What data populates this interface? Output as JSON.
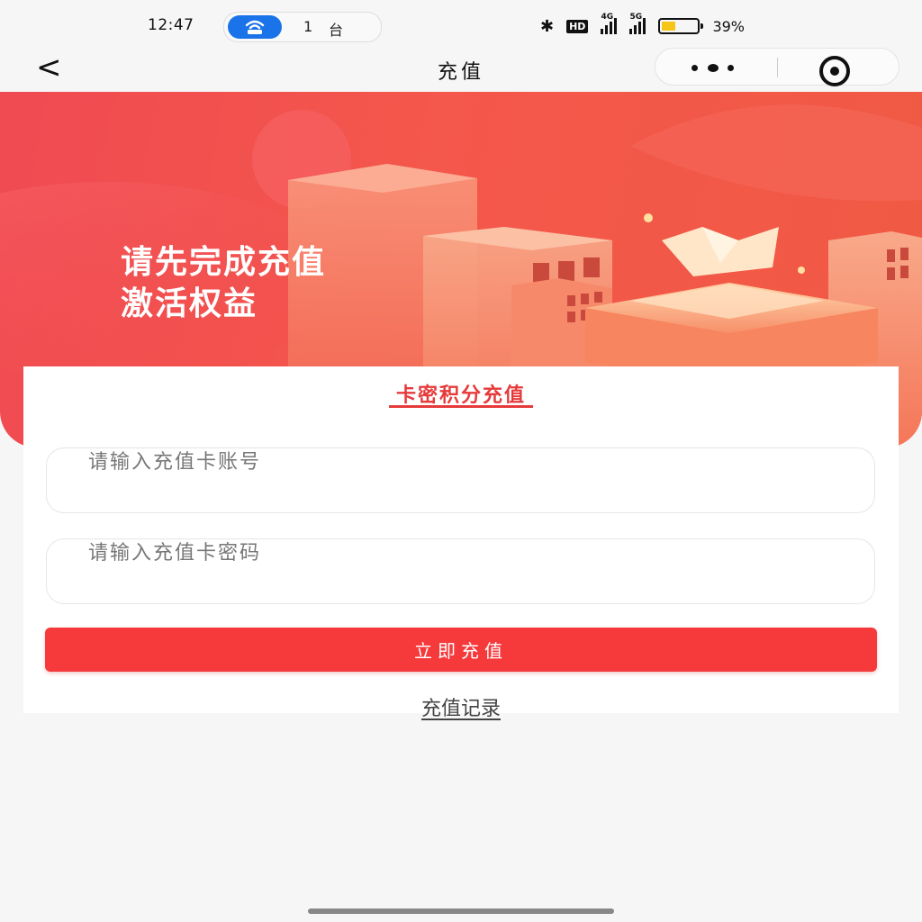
{
  "status_bar": {
    "time": "12:47",
    "hotspot_count": "1",
    "hotspot_unit": "台",
    "network_hd": "HD",
    "signal_1_label": "4G",
    "signal_2_label": "5G",
    "battery_percent_text": "39%",
    "battery_level": 0.39,
    "battery_color": "#f5c518"
  },
  "nav": {
    "back_icon": "<",
    "title": "充值"
  },
  "banner": {
    "line1": "请先完成充值",
    "line2": "激活权益"
  },
  "card": {
    "tab_label": "卡密积分充值",
    "account_placeholder": "请输入充值卡账号",
    "password_placeholder": "请输入充值卡密码",
    "submit_label": "立即充值",
    "history_label": "充值记录"
  },
  "colors": {
    "accent": "#f6393b",
    "tab_red": "#e63a3a",
    "banner_red": "#f04a52"
  }
}
